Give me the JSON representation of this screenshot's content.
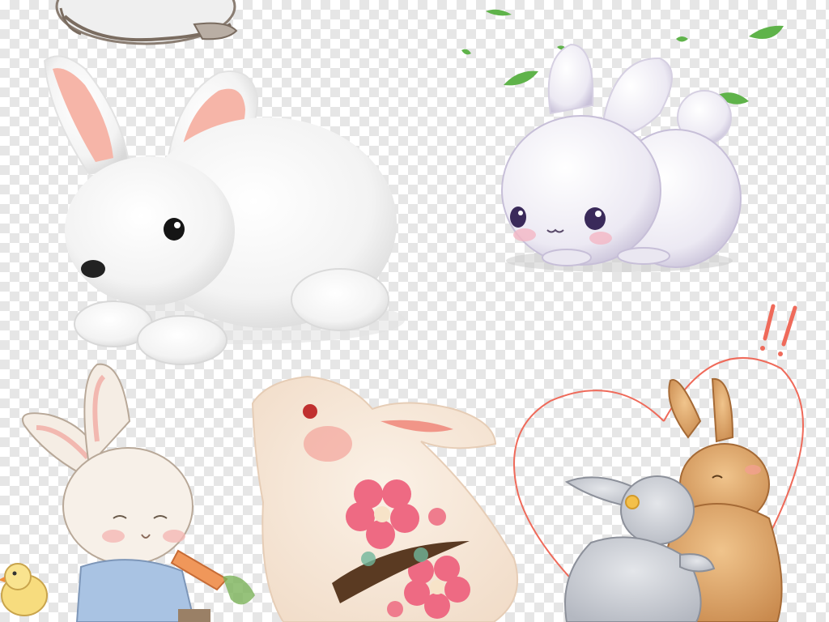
{
  "image": {
    "background": "transparency-checkerboard",
    "subjects": [
      "partial-rabbit-top-left",
      "fluffy-white-rabbit",
      "kawaii-rabbit-with-leaves",
      "rabbit-in-overalls-with-carrot",
      "floral-paper-rabbit",
      "two-hugging-rabbits-in-heart"
    ],
    "colors": {
      "checker_light": "#ffffff",
      "checker_dark": "#e6e6e6",
      "rabbit_white": "#f7f7f7",
      "ear_pink": "#f6b5a8",
      "leaf_green": "#5fb34a",
      "plum_pink": "#ef6f86",
      "heart_red": "#ef6a5a",
      "brown_rabbit": "#d9a064",
      "grey_rabbit": "#c9ccd3"
    }
  }
}
